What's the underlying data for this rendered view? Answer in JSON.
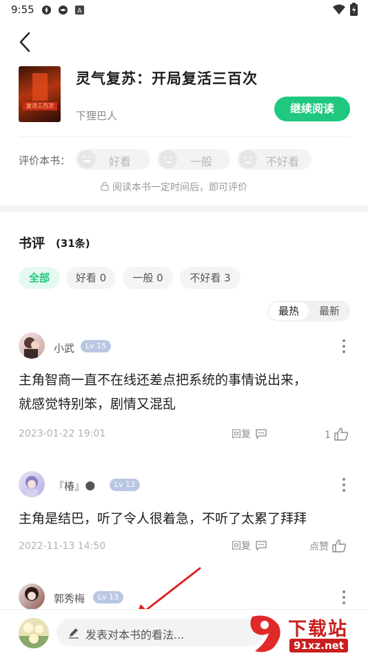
{
  "status_bar": {
    "time": "9:55"
  },
  "book": {
    "title": "灵气复苏：开局复活三百次",
    "author": "下狸巴人",
    "cover_text": "复活三百次",
    "continue_label": "继续阅读"
  },
  "rating": {
    "label": "评价本书：",
    "options": [
      "好看",
      "一般",
      "不好看"
    ],
    "hint": "阅读本书一定时间后，即可评价"
  },
  "reviews": {
    "title": "书评",
    "count": "(31条)",
    "filters": [
      "全部",
      "好看 0",
      "一般 0",
      "不好看 3"
    ],
    "sort": [
      "最热",
      "最新"
    ],
    "items": [
      {
        "user": "小武",
        "level": "Lv 15",
        "text_lines": [
          "主角智商一直不在线还差点把系统的事情说出来，",
          "就感觉特别笨，剧情又混乱"
        ],
        "date": "2023-01-22 19:01",
        "reply": "回复",
        "likes": "1"
      },
      {
        "user": "『椿』🌑",
        "level": "Lv 13",
        "text_lines": [
          "主角是结巴，听了令人很着急，不听了太累了拜拜"
        ],
        "date": "2022-11-13 14:50",
        "reply": "回复",
        "likes": "点赞"
      },
      {
        "user": "郭秀梅",
        "level": "Lv 13"
      }
    ]
  },
  "composer": {
    "placeholder": "发表对本书的看法..."
  },
  "watermark": {
    "text1": "下载站",
    "text2": "91xz.net"
  },
  "colors": {
    "accent": "#1fc77f",
    "level_badge": "#b9c7e2"
  }
}
